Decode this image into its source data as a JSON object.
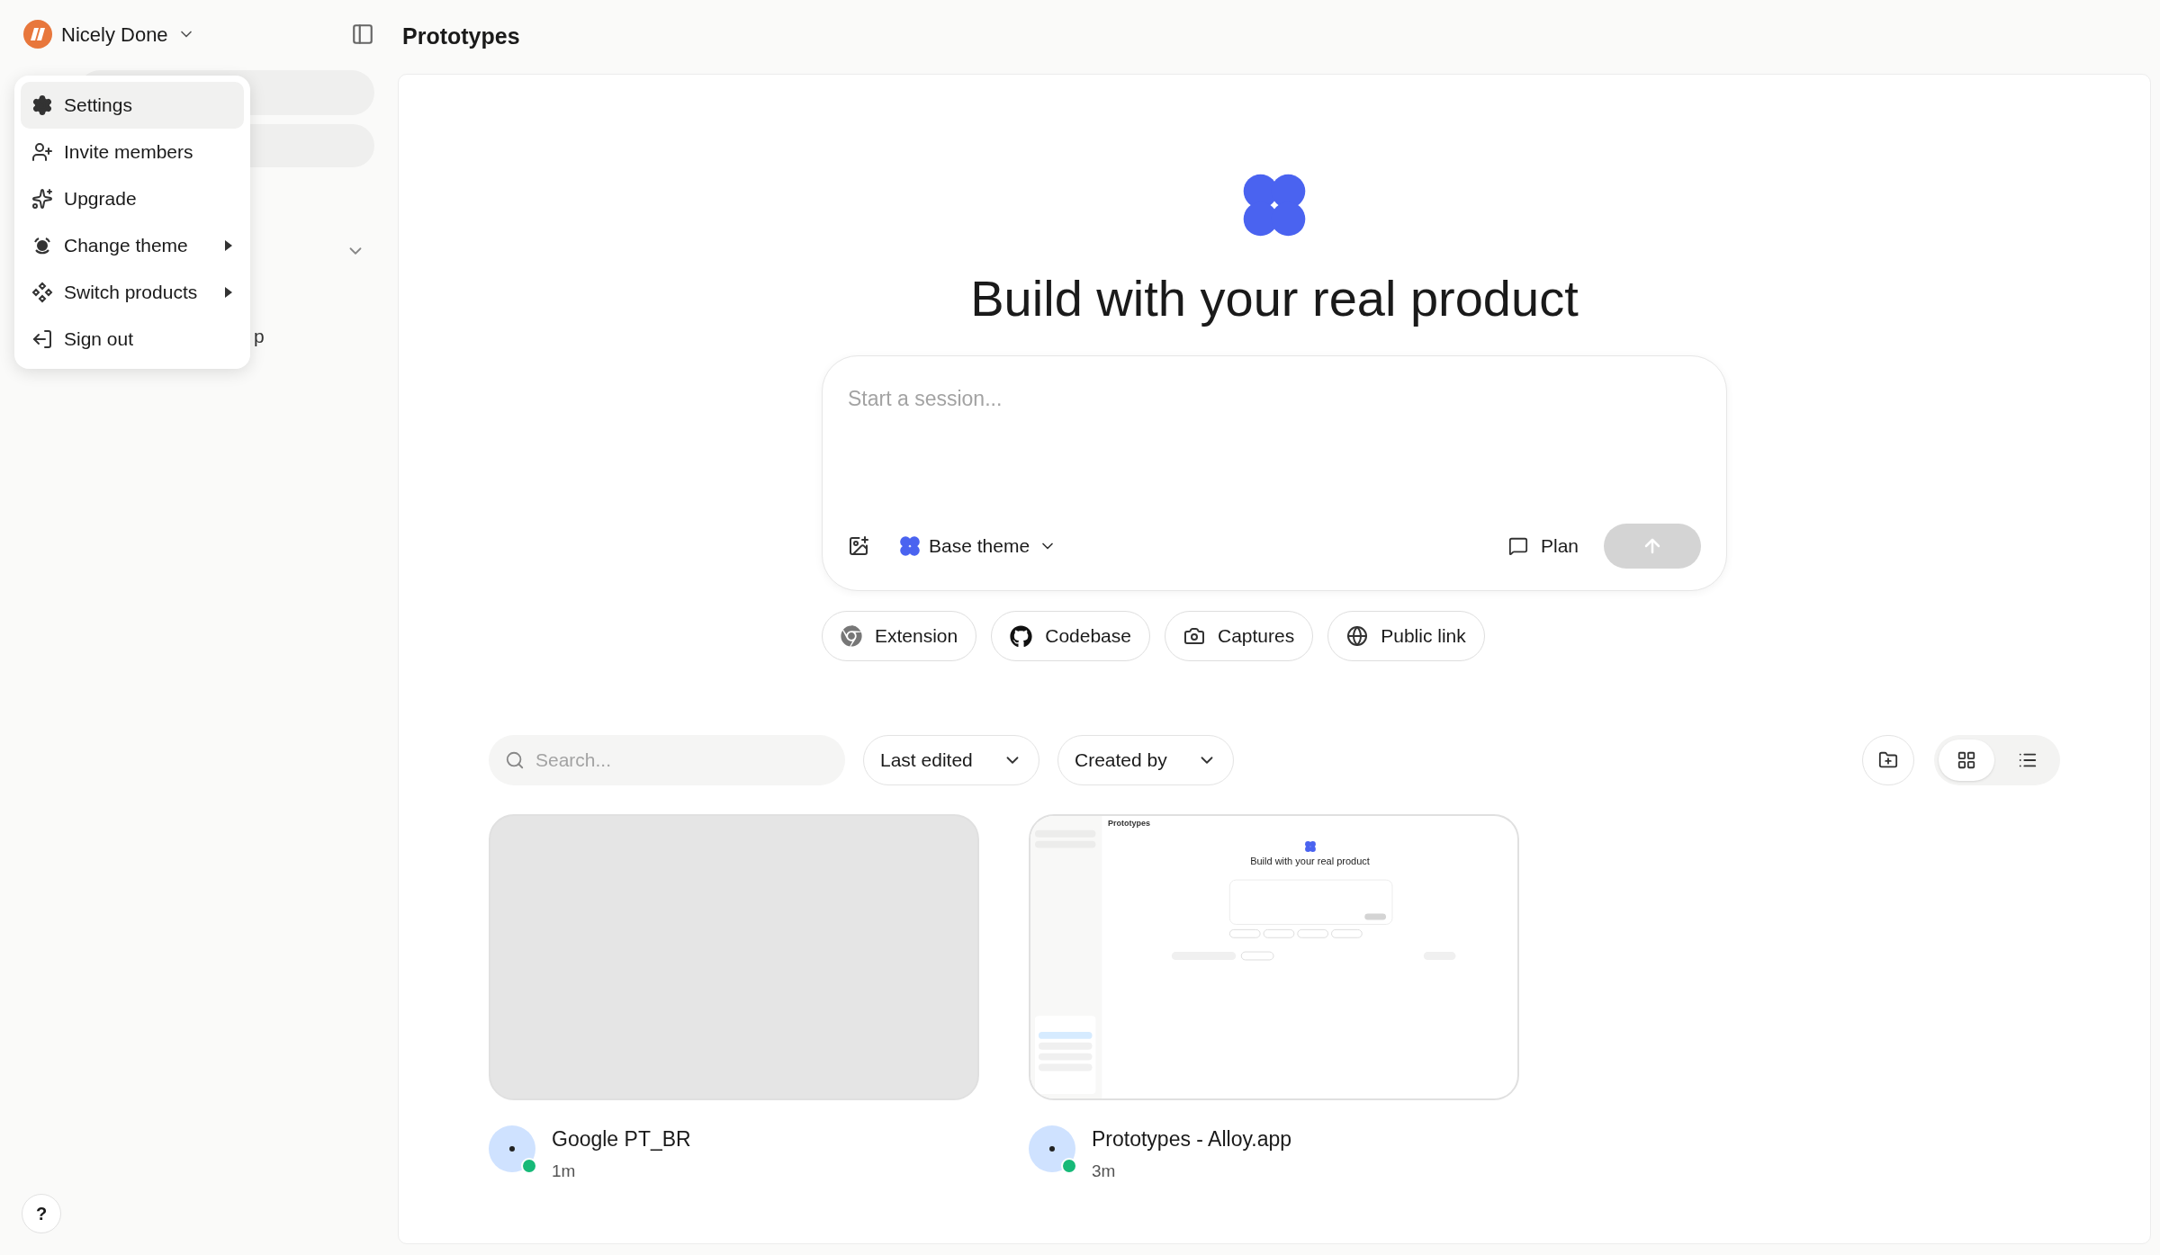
{
  "workspace": {
    "name": "Nicely Done"
  },
  "page_title": "Prototypes",
  "account_menu": {
    "items": [
      {
        "label": "Settings",
        "selected": true,
        "submenu": false
      },
      {
        "label": "Invite members",
        "selected": false,
        "submenu": false
      },
      {
        "label": "Upgrade",
        "selected": false,
        "submenu": false
      },
      {
        "label": "Change theme",
        "selected": false,
        "submenu": true
      },
      {
        "label": "Switch products",
        "selected": false,
        "submenu": true
      },
      {
        "label": "Sign out",
        "selected": false,
        "submenu": false
      }
    ]
  },
  "sidebar": {
    "visible_text": "p"
  },
  "help": "?",
  "hero": {
    "title": "Build with your real product"
  },
  "composer": {
    "placeholder": "Start a session...",
    "theme": "Base theme",
    "plan": "Plan",
    "send_disabled": true
  },
  "sources": [
    {
      "label": "Extension"
    },
    {
      "label": "Codebase"
    },
    {
      "label": "Captures"
    },
    {
      "label": "Public link"
    }
  ],
  "toolbar": {
    "search_placeholder": "Search...",
    "sort": "Last edited",
    "filter": "Created by",
    "views": [
      {
        "kind": "grid",
        "selected": true
      },
      {
        "kind": "list",
        "selected": false
      }
    ]
  },
  "projects": [
    {
      "name": "Google PT_BR",
      "time": "1m",
      "online": true
    },
    {
      "name": "Prototypes - Alloy.app",
      "time": "3m",
      "online": true,
      "screenshot": {
        "page_title": "Prototypes",
        "title": "Build with your real product"
      }
    }
  ]
}
